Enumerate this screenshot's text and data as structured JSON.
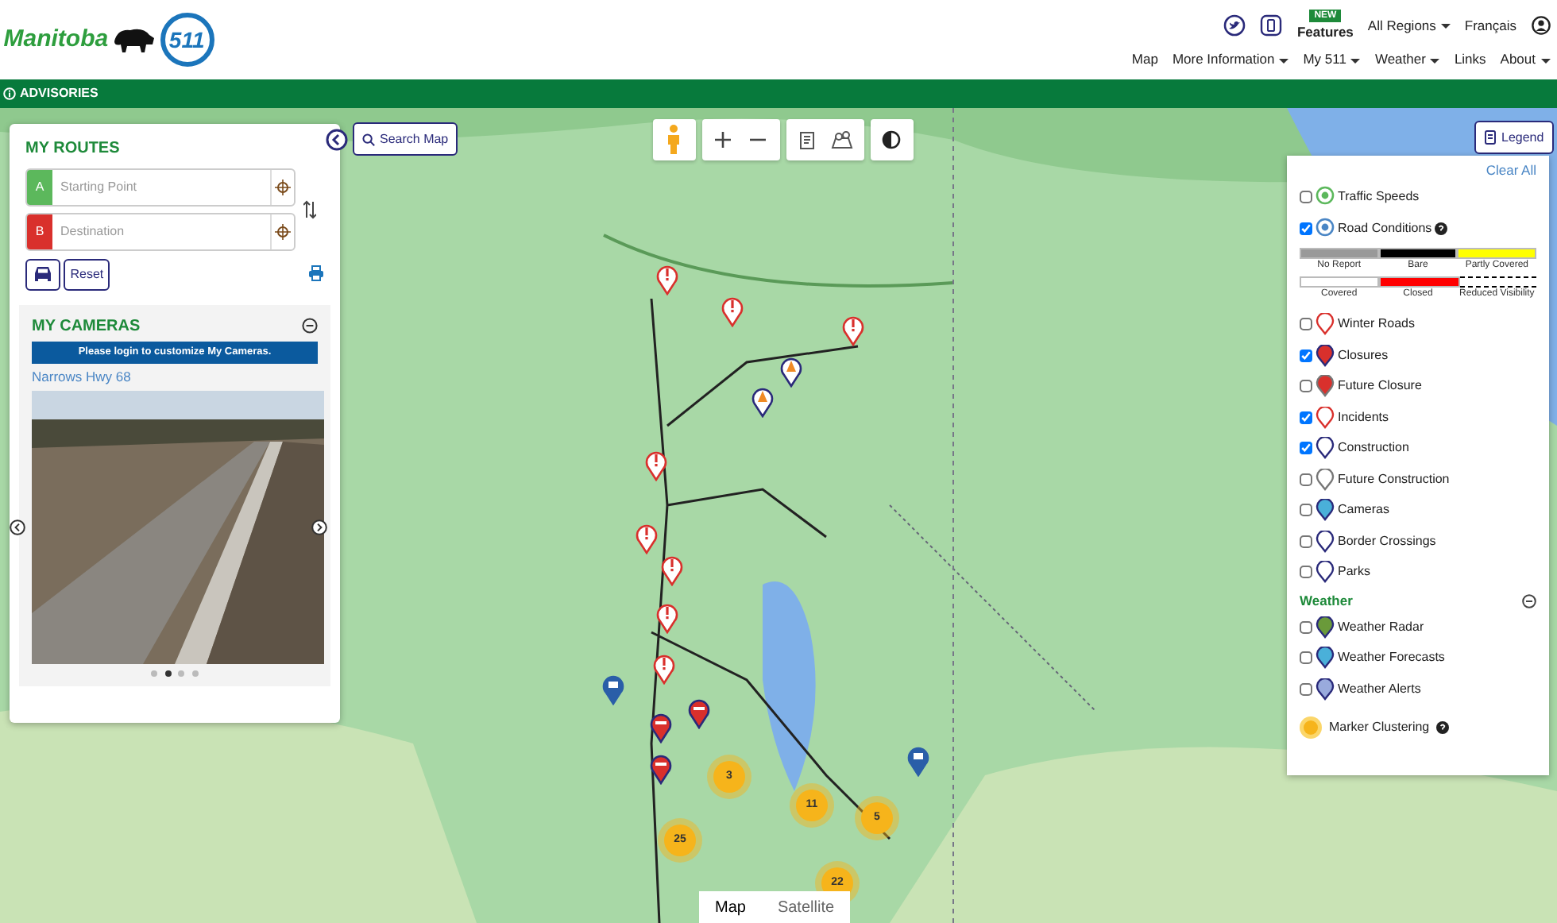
{
  "header": {
    "brand": "Manitoba",
    "logo_511": "511",
    "new_badge": "NEW",
    "features": "Features",
    "regions": "All Regions",
    "language": "Français"
  },
  "nav": [
    {
      "label": "Map",
      "dropdown": false
    },
    {
      "label": "More Information",
      "dropdown": true
    },
    {
      "label": "My 511",
      "dropdown": true
    },
    {
      "label": "Weather",
      "dropdown": true
    },
    {
      "label": "Links",
      "dropdown": false
    },
    {
      "label": "About",
      "dropdown": true
    }
  ],
  "advisories": "ADVISORIES",
  "routes": {
    "title": "MY ROUTES",
    "fields": [
      {
        "letter": "A",
        "placeholder": "Starting Point",
        "color": "#5cb85c"
      },
      {
        "letter": "B",
        "placeholder": "Destination",
        "color": "#d9302c"
      }
    ],
    "reset": "Reset"
  },
  "cameras": {
    "title": "MY CAMERAS",
    "login_notice": "Please login to customize My Cameras.",
    "camera_name": "Narrows Hwy 68",
    "slides": [
      {
        "selected": false
      },
      {
        "selected": true
      },
      {
        "selected": false
      },
      {
        "selected": false
      }
    ]
  },
  "search_map": "Search Map",
  "legend": {
    "button": "Legend",
    "clear_all": "Clear All",
    "layers": [
      {
        "kind": "speed",
        "label": "Traffic Speeds",
        "checked": false,
        "help": false
      },
      {
        "kind": "conditions",
        "label": "Road Conditions",
        "checked": true,
        "help": true
      }
    ],
    "scale_rows": [
      [
        {
          "label": "No Report",
          "color": "#999999",
          "kind": "solid"
        },
        {
          "label": "Bare",
          "color": "#000000",
          "kind": "solid"
        },
        {
          "label": "Partly Covered",
          "color": "#ffff00",
          "kind": "solid"
        }
      ],
      [
        {
          "label": "Covered",
          "color": "#ffffff",
          "kind": "solid"
        },
        {
          "label": "Closed",
          "color": "#ff0000",
          "kind": "solid"
        },
        {
          "label": "Reduced Visibility",
          "color": "#000000",
          "kind": "dashed"
        }
      ]
    ],
    "events": [
      {
        "kind": "winter",
        "label": "Winter Roads",
        "checked": false
      },
      {
        "kind": "closure",
        "label": "Closures",
        "checked": true
      },
      {
        "kind": "future_closure",
        "label": "Future Closure",
        "checked": false
      },
      {
        "kind": "incident",
        "label": "Incidents",
        "checked": true
      },
      {
        "kind": "construction",
        "label": "Construction",
        "checked": true
      },
      {
        "kind": "future_construction",
        "label": "Future Construction",
        "checked": false
      },
      {
        "kind": "camera",
        "label": "Cameras",
        "checked": false
      },
      {
        "kind": "border",
        "label": "Border Crossings",
        "checked": false
      },
      {
        "kind": "park",
        "label": "Parks",
        "checked": false
      }
    ],
    "weather_title": "Weather",
    "weather": [
      {
        "kind": "radar",
        "label": "Weather Radar",
        "checked": false
      },
      {
        "kind": "forecast",
        "label": "Weather Forecasts",
        "checked": false
      },
      {
        "kind": "alert",
        "label": "Weather Alerts",
        "checked": false
      }
    ],
    "clustering": "Marker Clustering"
  },
  "map_markers": [
    {
      "kind": "incident"
    },
    {
      "kind": "incident"
    },
    {
      "kind": "incident"
    },
    {
      "kind": "incident"
    },
    {
      "kind": "incident"
    },
    {
      "kind": "incident"
    },
    {
      "kind": "incident"
    },
    {
      "kind": "incident"
    },
    {
      "kind": "construction"
    },
    {
      "kind": "construction"
    },
    {
      "kind": "closure"
    },
    {
      "kind": "closure"
    },
    {
      "kind": "closure"
    },
    {
      "kind": "camera"
    },
    {
      "kind": "camera"
    },
    {
      "kind": "cluster",
      "count": "3"
    },
    {
      "kind": "cluster",
      "count": "11"
    },
    {
      "kind": "cluster",
      "count": "5"
    },
    {
      "kind": "cluster",
      "count": "25"
    },
    {
      "kind": "cluster",
      "count": "22"
    }
  ],
  "map_type": [
    {
      "label": "Map",
      "selected": true
    },
    {
      "label": "Satellite",
      "selected": false
    }
  ]
}
